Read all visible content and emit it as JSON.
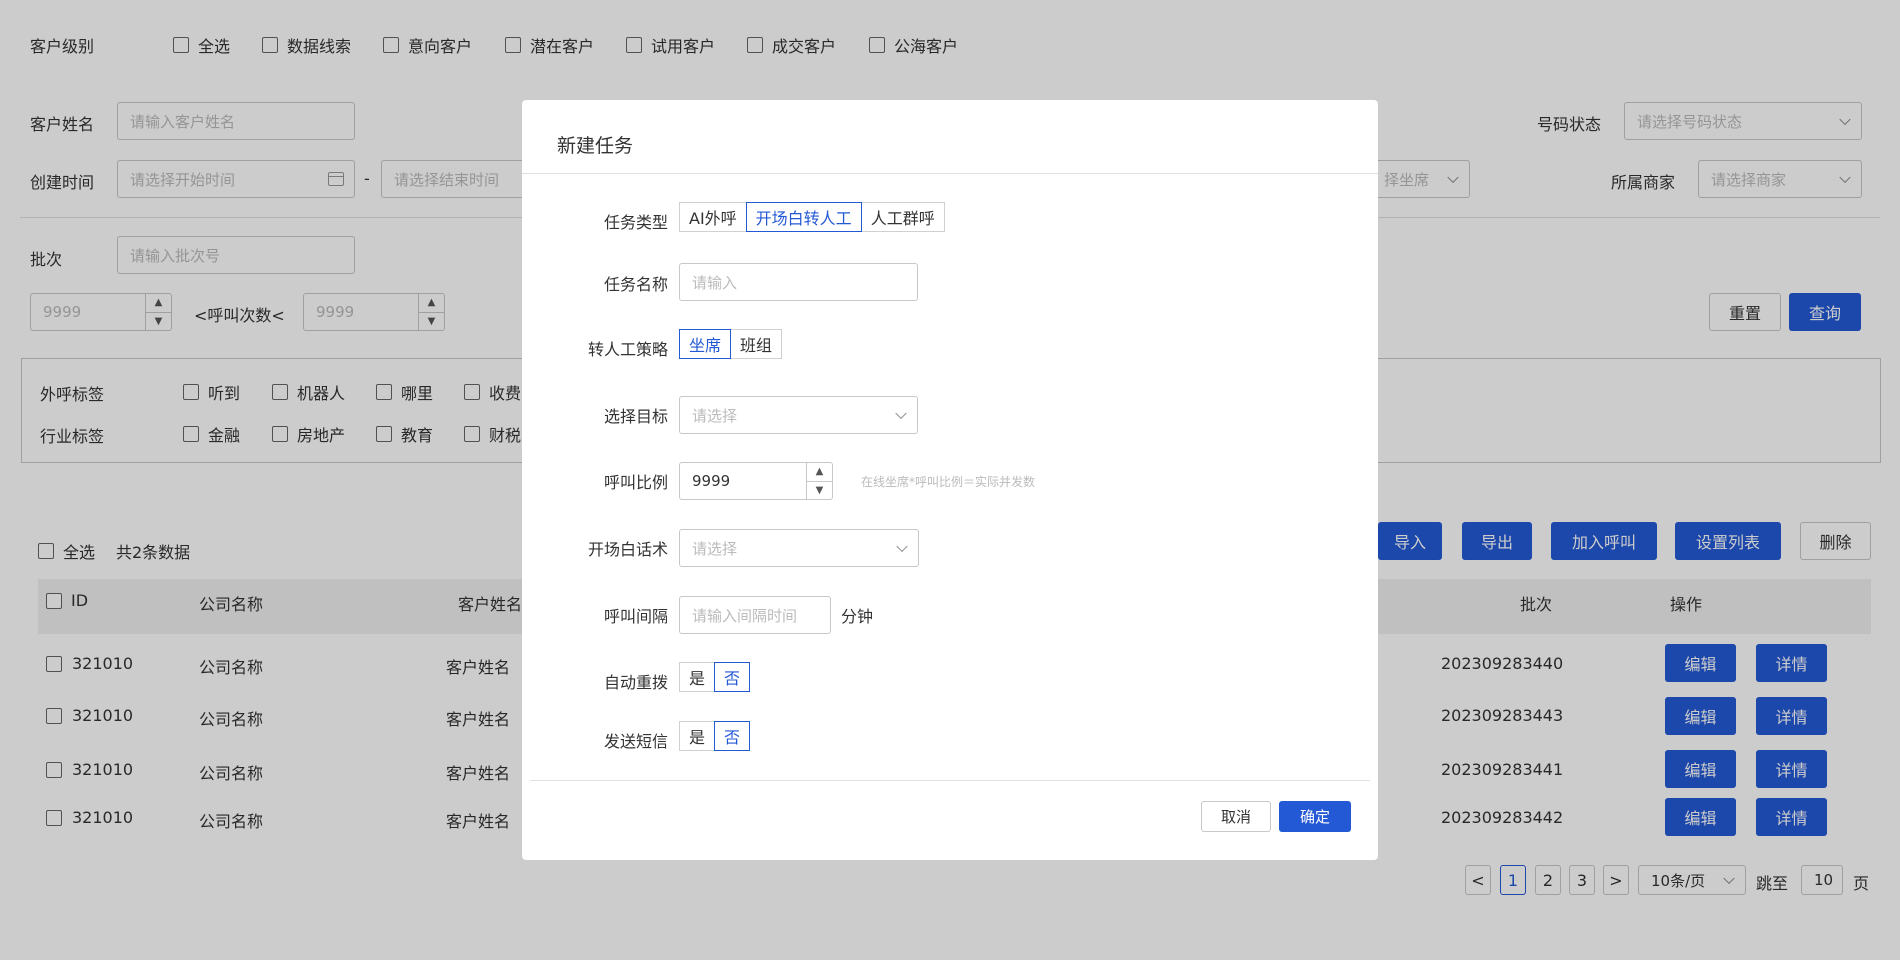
{
  "filters": {
    "level_label": "客户级别",
    "level_options": [
      "全选",
      "数据线索",
      "意向客户",
      "潜在客户",
      "试用客户",
      "成交客户",
      "公海客户"
    ],
    "name_label": "客户姓名",
    "name_placeholder": "请输入客户姓名",
    "created_label": "创建时间",
    "start_placeholder": "请选择开始时间",
    "dash": "-",
    "end_placeholder": "请选择结束时间",
    "seat_placeholder_partial": "择坐席",
    "number_status_label": "号码状态",
    "number_status_placeholder": "请选择号码状态",
    "merchant_label": "所属商家",
    "merchant_placeholder": "请选择商家",
    "batch_label": "批次",
    "batch_placeholder": "请输入批次号",
    "calls_min_placeholder": "9999",
    "calls_label": "<呼叫次数<",
    "calls_max_placeholder": "9999",
    "reset_label": "重置",
    "query_label": "查询"
  },
  "tags": {
    "outbound_label": "外呼标签",
    "outbound_options": [
      "听到",
      "机器人",
      "哪里",
      "收费"
    ],
    "industry_label": "行业标签",
    "industry_options": [
      "金融",
      "房地产",
      "教育",
      "财税"
    ]
  },
  "toolbar": {
    "select_all": "全选",
    "total": "共2条数据",
    "import": "导入",
    "export": "导出",
    "add_call": "加入呼叫",
    "set_columns": "设置列表",
    "delete": "删除"
  },
  "table": {
    "headers": {
      "id": "ID",
      "company": "公司名称",
      "customer": "客户姓名",
      "batch": "批次",
      "actions": "操作"
    },
    "rows": [
      {
        "id": "321010",
        "company": "公司名称",
        "customer": "客户姓名",
        "batch": "202309283440",
        "edit": "编辑",
        "detail": "详情"
      },
      {
        "id": "321010",
        "company": "公司名称",
        "customer": "客户姓名",
        "batch": "202309283443",
        "edit": "编辑",
        "detail": "详情"
      },
      {
        "id": "321010",
        "company": "公司名称",
        "customer": "客户姓名",
        "batch": "202309283441",
        "edit": "编辑",
        "detail": "详情"
      },
      {
        "id": "321010",
        "company": "公司名称",
        "customer": "客户姓名",
        "batch": "202309283442",
        "edit": "编辑",
        "detail": "详情"
      }
    ]
  },
  "pagination": {
    "prev": "<",
    "pages": [
      "1",
      "2",
      "3"
    ],
    "next": ">",
    "page_size": "10条/页",
    "jump_label": "跳至",
    "jump_value": "10",
    "page_unit": "页"
  },
  "modal": {
    "title": "新建任务",
    "task_type_label": "任务类型",
    "task_types": [
      "AI外呼",
      "开场白转人工",
      "人工群呼"
    ],
    "task_name_label": "任务名称",
    "task_name_placeholder": "请输入",
    "transfer_label": "转人工策略",
    "transfer_options": [
      "坐席",
      "班组"
    ],
    "target_label": "选择目标",
    "target_placeholder": "请选择",
    "ratio_label": "呼叫比例",
    "ratio_value": "9999",
    "ratio_hint": "在线坐席*呼叫比例＝实际并发数",
    "opening_label": "开场白话术",
    "opening_placeholder": "请选择",
    "interval_label": "呼叫间隔",
    "interval_placeholder": "请输入间隔时间",
    "interval_unit": "分钟",
    "redial_label": "自动重拨",
    "sms_label": "发送短信",
    "yes": "是",
    "no": "否",
    "cancel": "取消",
    "confirm": "确定"
  },
  "colors": {
    "accent": "#2459d6",
    "overlay": "rgba(0,0,0,0.2)"
  }
}
